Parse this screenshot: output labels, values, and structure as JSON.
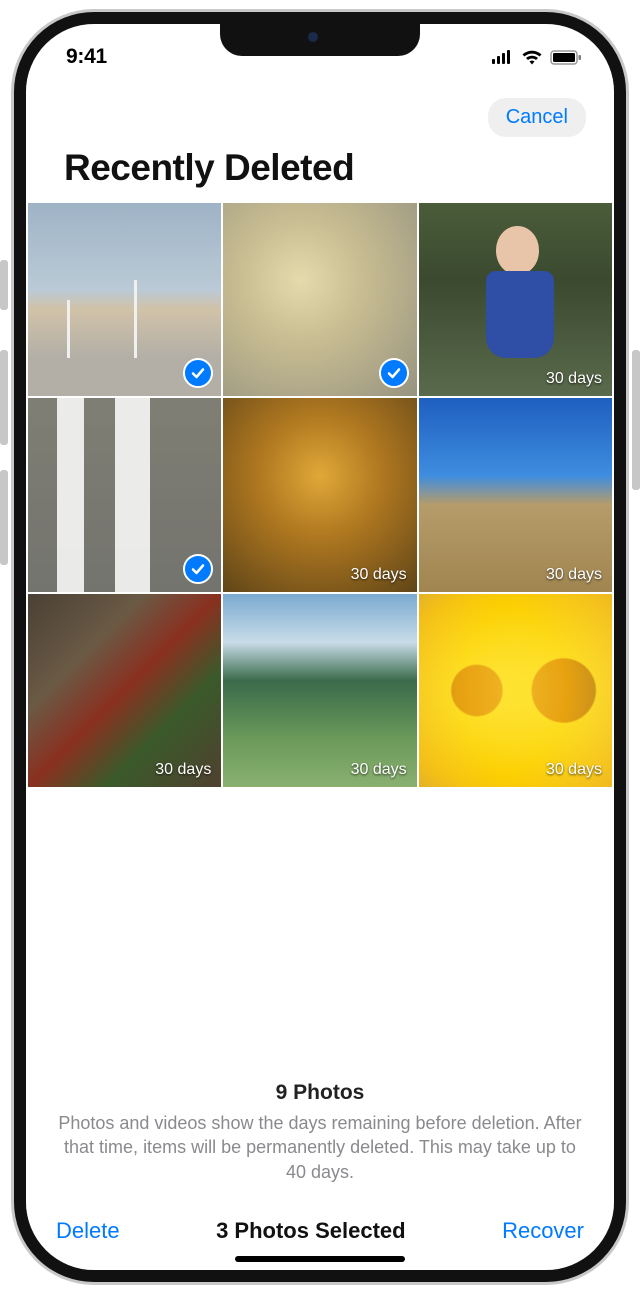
{
  "status": {
    "time": "9:41"
  },
  "header": {
    "cancel_label": "Cancel",
    "title": "Recently Deleted"
  },
  "photos": [
    {
      "name": "wind-turbines",
      "days_label": "",
      "selected": true,
      "art": "art-wind"
    },
    {
      "name": "cholla-cactus",
      "days_label": "",
      "selected": true,
      "art": "art-cactus"
    },
    {
      "name": "baby-by-stream",
      "days_label": "30 days",
      "selected": false,
      "art": "art-baby"
    },
    {
      "name": "waterfall",
      "days_label": "",
      "selected": true,
      "art": "art-waterfall"
    },
    {
      "name": "bees-honeycomb",
      "days_label": "30 days",
      "selected": false,
      "art": "art-bees"
    },
    {
      "name": "desert-road",
      "days_label": "30 days",
      "selected": false,
      "art": "art-desert"
    },
    {
      "name": "compost-bin",
      "days_label": "30 days",
      "selected": false,
      "art": "art-compost"
    },
    {
      "name": "green-mountains",
      "days_label": "30 days",
      "selected": false,
      "art": "art-mountain"
    },
    {
      "name": "sunflowers",
      "days_label": "30 days",
      "selected": false,
      "art": "art-sunflower"
    }
  ],
  "footer": {
    "count_label": "9 Photos",
    "note": "Photos and videos show the days remaining before deletion. After that time, items will be permanently deleted. This may take up to 40 days."
  },
  "toolbar": {
    "delete_label": "Delete",
    "selected_label": "3 Photos Selected",
    "recover_label": "Recover"
  }
}
